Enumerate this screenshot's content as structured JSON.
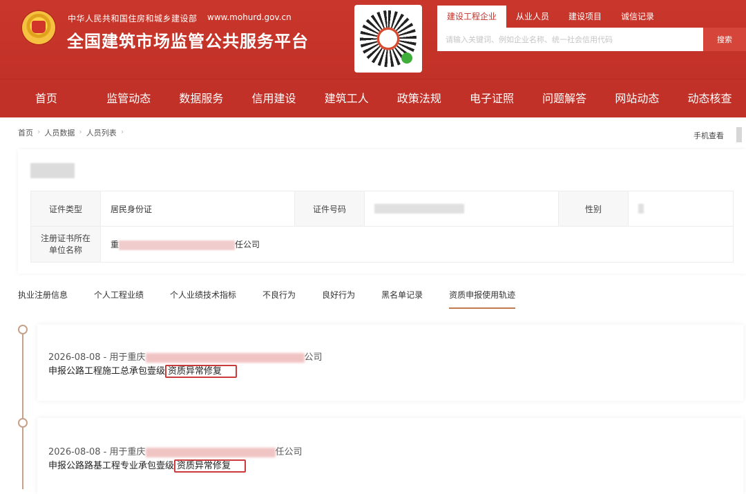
{
  "header": {
    "ministry": "中华人民共和国住房和城乡建设部",
    "url": "www.mohurd.gov.cn",
    "title": "全国建筑市场监管公共服务平台"
  },
  "search": {
    "tabs": [
      "建设工程企业",
      "从业人员",
      "建设项目",
      "诚信记录"
    ],
    "active_tab": 0,
    "placeholder": "请输入关键词、例如企业名称、统一社会信用代码",
    "button": "搜索"
  },
  "nav": {
    "items": [
      "首页",
      "监管动态",
      "数据服务",
      "信用建设",
      "建筑工人",
      "政策法规",
      "电子证照",
      "问题解答",
      "网站动态",
      "动态核查"
    ]
  },
  "breadcrumb": {
    "items": [
      "首页",
      "人员数据",
      "人员列表"
    ],
    "mobile_link": "手机查看"
  },
  "person": {
    "id_type_label": "证件类型",
    "id_type_value": "居民身份证",
    "id_number_label": "证件号码",
    "gender_label": "性别",
    "company_label": "注册证书所在单位名称",
    "company_prefix": "重",
    "company_suffix": "任公司"
  },
  "tabs": {
    "items": [
      "执业注册信息",
      "个人工程业绩",
      "个人业绩技术指标",
      "不良行为",
      "良好行为",
      "黑名单记录",
      "资质申报使用轨迹"
    ],
    "active": 6
  },
  "timeline": [
    {
      "date_prefix": "2026-08-08 - 用于重庆",
      "company_suffix": "公司",
      "desc": "申报公路工程施工总承包壹级",
      "status": "资质异常修复"
    },
    {
      "date_prefix": "2026-08-08 - 用于重庆",
      "company_suffix": "任公司",
      "desc": "申报公路路基工程专业承包壹级",
      "status": "资质异常修复"
    }
  ]
}
